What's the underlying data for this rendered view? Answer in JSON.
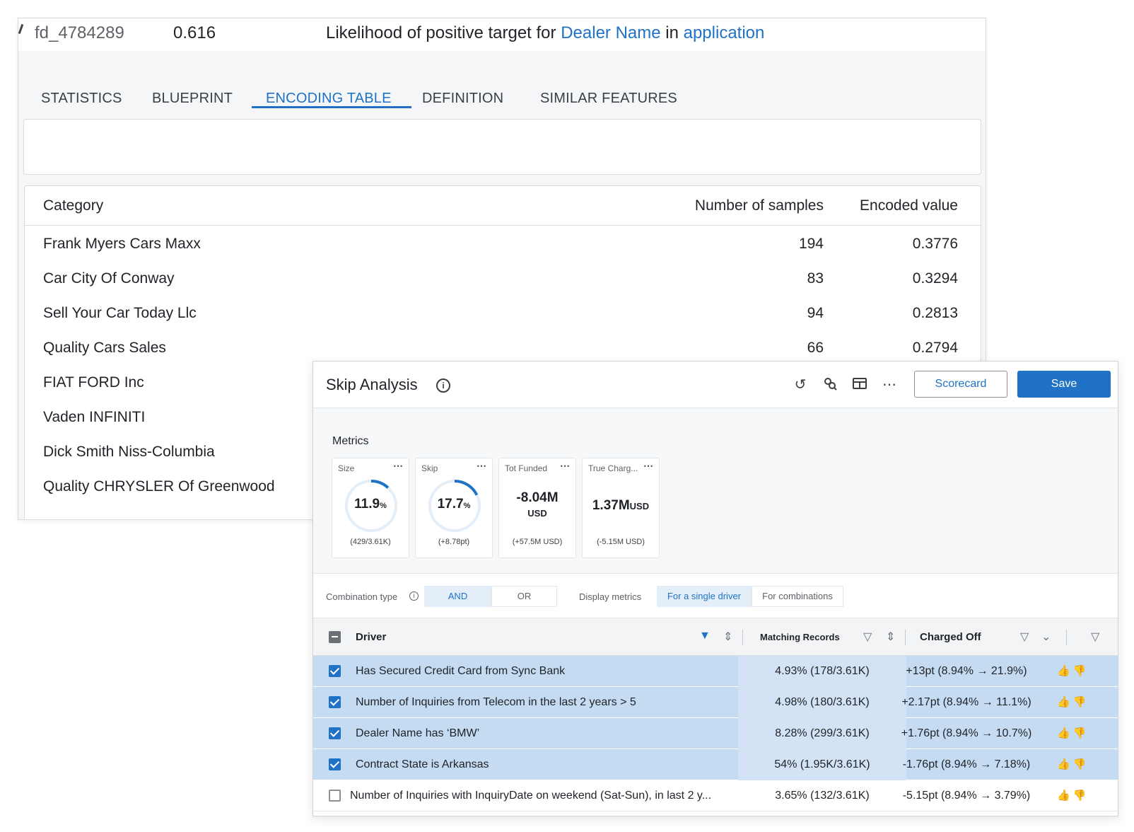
{
  "back": {
    "feature_id": "fd_4784289",
    "feature_value": "0.616",
    "desc_prefix": "Likelihood of positive target for ",
    "desc_link1": "Dealer Name",
    "desc_mid": " in ",
    "desc_link2": "application",
    "tabs": [
      "STATISTICS",
      "BLUEPRINT",
      "ENCODING TABLE",
      "DEFINITION",
      "SIMILAR FEATURES"
    ],
    "active_tab": "ENCODING TABLE",
    "table": {
      "headers": [
        "Category",
        "Number of samples",
        "Encoded value"
      ],
      "rows": [
        [
          "Frank Myers Cars Maxx",
          "194",
          "0.3776"
        ],
        [
          "Car City Of Conway",
          "83",
          "0.3294"
        ],
        [
          "Sell Your Car Today Llc",
          "94",
          "0.2813"
        ],
        [
          "Quality Cars Sales",
          "66",
          "0.2794"
        ],
        [
          "FIAT FORD Inc",
          "",
          ""
        ],
        [
          "Vaden INFINITI",
          "",
          ""
        ],
        [
          "Dick Smith Niss-Columbia",
          "",
          ""
        ],
        [
          "Quality CHRYSLER Of Greenwood",
          "",
          ""
        ]
      ]
    }
  },
  "front": {
    "title": "Skip Analysis",
    "scorecard_label": "Scorecard",
    "save_label": "Save",
    "metrics_label": "Metrics",
    "metrics": [
      {
        "title": "Size",
        "value": "11.9",
        "unit": "%",
        "sub": "(429/3.61K)",
        "fraction": 0.119
      },
      {
        "title": "Skip",
        "value": "17.7",
        "unit": "%",
        "sub": "(+8.78pt)",
        "fraction": 0.177
      },
      {
        "title": "Tot Funded",
        "value": "-8.04M",
        "unit": "USD",
        "sub": "(+57.5M USD)"
      },
      {
        "title": "True Charg...",
        "value": "1.37M",
        "unit": "USD",
        "sub": "(-5.15M USD)"
      }
    ],
    "combination_type_label": "Combination type",
    "combination_options": [
      "AND",
      "OR"
    ],
    "combination_selected": "AND",
    "display_metrics_label": "Display metrics",
    "display_options": [
      "For a single driver",
      "For combinations"
    ],
    "display_selected": "For a single driver",
    "columns": {
      "driver": "Driver",
      "matching": "Matching Records",
      "charged": "Charged Off"
    },
    "rows": [
      {
        "driver": "Has Secured Credit Card from Sync Bank",
        "matching": "4.93% (178/3.61K)",
        "charged": "+13pt (8.94% → 21.9%)",
        "checked": true
      },
      {
        "driver": "Number of Inquiries from Telecom in the last 2 years > 5",
        "matching": "4.98% (180/3.61K)",
        "charged": "+2.17pt (8.94% → 11.1%)",
        "checked": true
      },
      {
        "driver": "Dealer Name has ‘BMW’",
        "matching": "8.28% (299/3.61K)",
        "charged": "+1.76pt (8.94% → 10.7%)",
        "checked": true
      },
      {
        "driver": "Contract State is Arkansas",
        "matching": "54% (1.95K/3.61K)",
        "charged": "-1.76pt (8.94% → 7.18%)",
        "checked": true
      },
      {
        "driver": "Number of Inquiries with InquiryDate on weekend (Sat-Sun), in last 2 y...",
        "matching": "3.65% (132/3.61K)",
        "charged": "-5.15pt (8.94% → 3.79%)",
        "checked": false
      }
    ],
    "colors": {
      "accent": "#1f72c6",
      "selected_row": "#c5dbf2"
    }
  }
}
